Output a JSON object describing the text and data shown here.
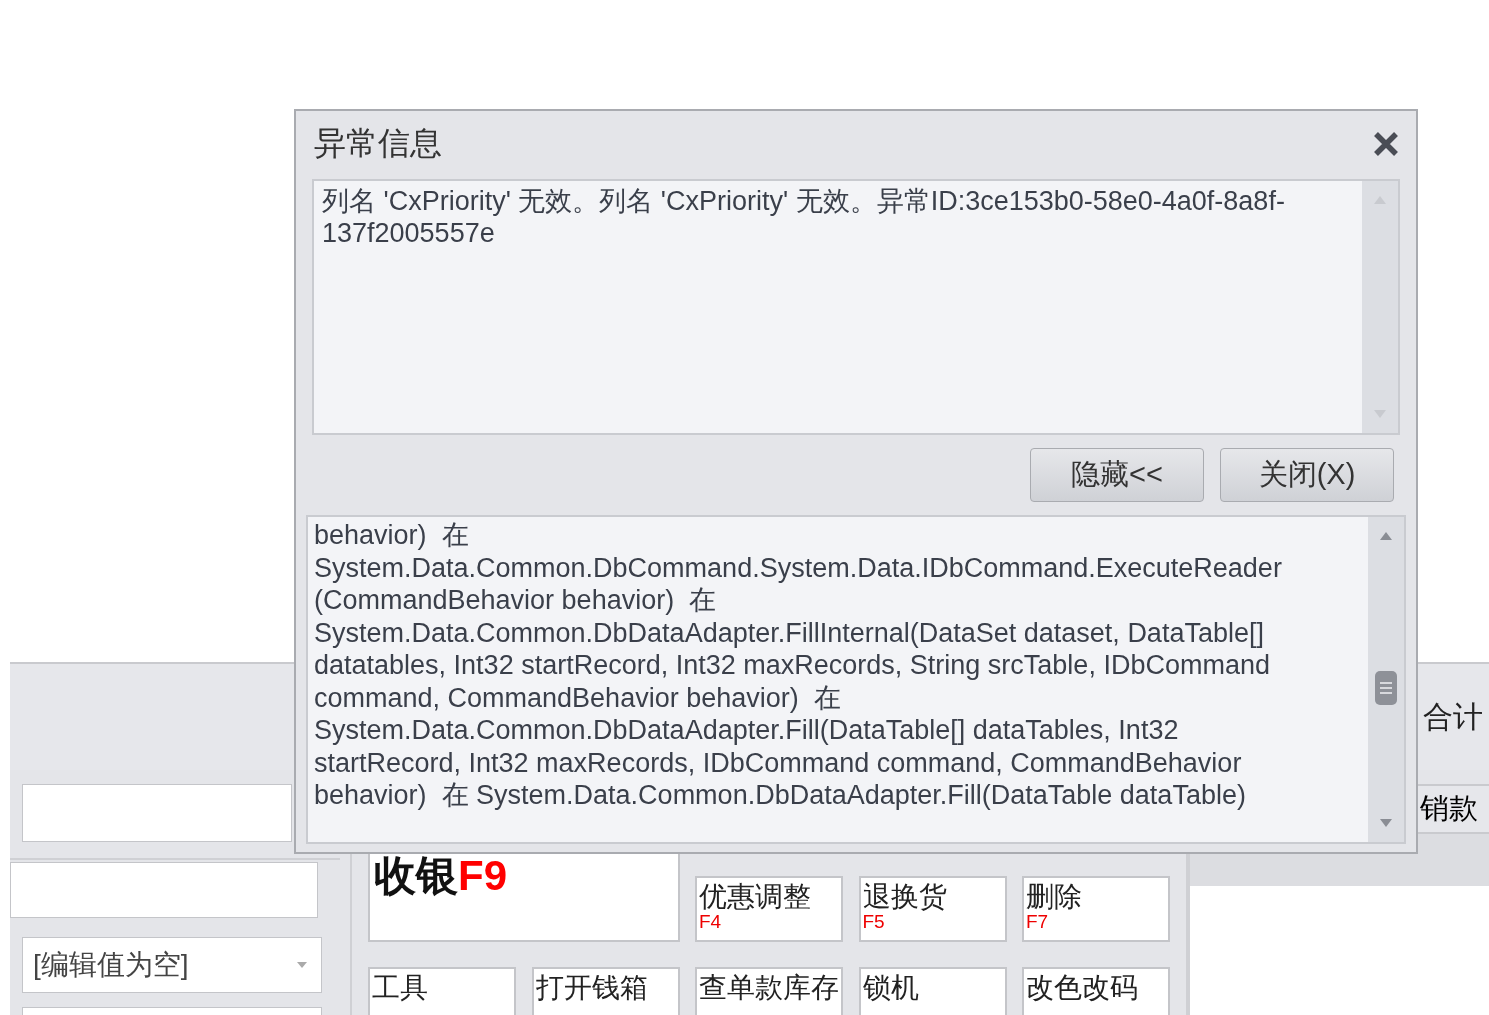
{
  "dialog": {
    "title": "异常信息",
    "message": "列名 'CxPriority' 无效。列名 'CxPriority' 无效。异常ID:3ce153b0-58e0-4a0f-8a8f-137f2005557e",
    "buttons": [
      {
        "label": "隐藏<<"
      },
      {
        "label": "关闭(X)"
      }
    ],
    "details": [
      "behavior)  在",
      "System.Data.Common.DbCommand.System.Data.IDbCommand.ExecuteReader",
      "(CommandBehavior behavior)  在",
      "System.Data.Common.DbDataAdapter.FillInternal(DataSet dataset, DataTable[]",
      "datatables, Int32 startRecord, Int32 maxRecords, String srcTable, IDbCommand",
      "command, CommandBehavior behavior)  在",
      "System.Data.Common.DbDataAdapter.Fill(DataTable[] dataTables, Int32",
      "startRecord, Int32 maxRecords, IDbCommand command, CommandBehavior",
      "behavior)  在 System.Data.Common.DbDataAdapter.Fill(DataTable dataTable)"
    ]
  },
  "background": {
    "summary_label": "合计",
    "column_header": "销款",
    "dropdown": {
      "placeholder": "[编辑值为空]"
    },
    "checkout_button": {
      "label": "收银",
      "key": "F9"
    },
    "function_buttons": [
      {
        "label": "优惠调整",
        "key": "F4"
      },
      {
        "label": "退换货",
        "key": "F5"
      },
      {
        "label": "删除",
        "key": "F7"
      },
      {
        "label": "工具"
      },
      {
        "label": "打开钱箱"
      },
      {
        "label": "查单款库存"
      },
      {
        "label": "锁机"
      },
      {
        "label": "改色改码"
      }
    ]
  }
}
